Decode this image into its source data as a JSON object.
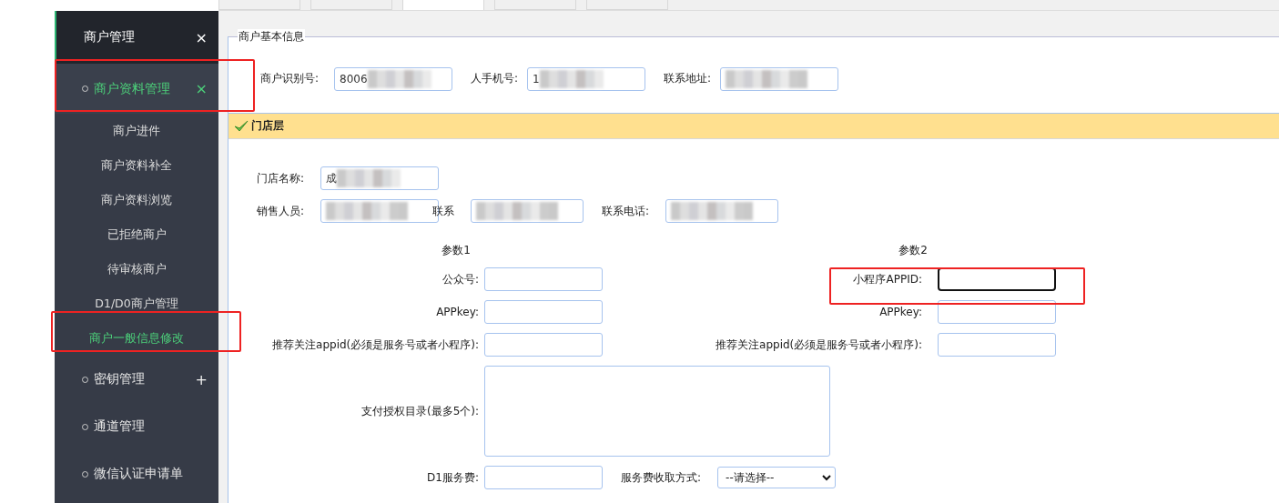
{
  "top_tabs": [
    {
      "selected": false
    },
    {
      "selected": false
    },
    {
      "selected": true
    },
    {
      "selected": false
    },
    {
      "selected": false
    }
  ],
  "sidebar": {
    "header": {
      "label": "商户管理",
      "close": "×"
    },
    "items": [
      {
        "label": "商户资料管理",
        "selected": true,
        "toggle": "×",
        "children": [
          {
            "label": "商户进件",
            "selected": false
          },
          {
            "label": "商户资料补全",
            "selected": false
          },
          {
            "label": "商户资料浏览",
            "selected": false
          },
          {
            "label": "已拒绝商户",
            "selected": false
          },
          {
            "label": "待审核商户",
            "selected": false
          },
          {
            "label": "D1/D0商户管理",
            "selected": false
          },
          {
            "label": "商户一般信息修改",
            "selected": true
          }
        ]
      },
      {
        "label": "密钥管理",
        "selected": false,
        "toggle": "+"
      },
      {
        "label": "通道管理",
        "selected": false
      },
      {
        "label": "微信认证申请单",
        "selected": false
      }
    ]
  },
  "basic_info": {
    "legend": "商户基本信息",
    "fields": [
      {
        "label": "商户识别号:",
        "value": "8006",
        "redacted": true
      },
      {
        "label": "人手机号:",
        "value": "1",
        "redacted": true
      },
      {
        "label": "联系地址:",
        "redacted": true
      }
    ]
  },
  "store": {
    "title": "门店层",
    "rows": [
      [
        {
          "label": "门店名称:",
          "value": "成",
          "redacted": true
        }
      ],
      [
        {
          "label": "销售人员:",
          "redacted": true
        },
        {
          "label": "联系",
          "redacted": true
        },
        {
          "label": "联系电话:",
          "redacted": true
        }
      ]
    ],
    "params": {
      "column_1": "参数1",
      "column_2": "参数2",
      "rows": [
        {
          "left": {
            "label": "公众号:",
            "focused": false
          },
          "right": {
            "label": "小程序APPID:",
            "focused": true
          }
        },
        {
          "left": {
            "label": "APPkey:",
            "focused": false
          },
          "right": {
            "label": "APPkey:",
            "focused": false
          }
        },
        {
          "left": {
            "label": "推荐关注appid(必须是服务号或者小程序):",
            "focused": false
          },
          "right": {
            "label": "推荐关注appid(必须是服务号或者小程序):",
            "focused": false
          }
        }
      ]
    },
    "textarea_label": "支付授权目录(最多5个):",
    "fee": {
      "label": "D1服务费:",
      "method_label": "服务费收取方式:",
      "method_value": "--请选择--"
    }
  }
}
